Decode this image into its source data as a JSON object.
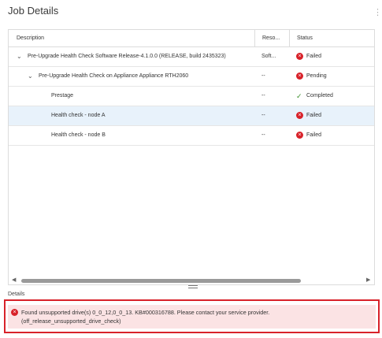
{
  "header": {
    "title": "Job Details",
    "more_icon": "⋮"
  },
  "table": {
    "columns": [
      "Description",
      "Reso...",
      "Status"
    ],
    "rows": [
      {
        "description": "Pre-Upgrade Health Check Software Release-4.1.0.0 (RELEASE, build 2435323)",
        "resource": "Soft...",
        "status": "Failed",
        "status_icon": "error-icon",
        "expanded": true
      },
      {
        "description": "Pre-Upgrade Health Check on Appliance Appliance RTH2060",
        "resource": "--",
        "status": "Pending",
        "status_icon": "error-icon",
        "expanded": true
      },
      {
        "description": "Prestage",
        "resource": "--",
        "status": "Completed",
        "status_icon": "check-icon"
      },
      {
        "description": "Health check - node A",
        "resource": "--",
        "status": "Failed",
        "status_icon": "error-icon",
        "selected": true
      },
      {
        "description": "Health check - node B",
        "resource": "--",
        "status": "Failed",
        "status_icon": "error-icon"
      }
    ]
  },
  "details": {
    "label": "Details",
    "error_line1": "Found unsupported drive(s) 0_0_12,0_0_13. KB#000316788. Please contact your service provider.",
    "error_line2": "(off_release_unsupported_drive_check)"
  },
  "colors": {
    "error": "#d8222a",
    "success": "#3c8f2b",
    "selected_row": "#e8f2fb",
    "error_bg": "#fbe3e4"
  }
}
